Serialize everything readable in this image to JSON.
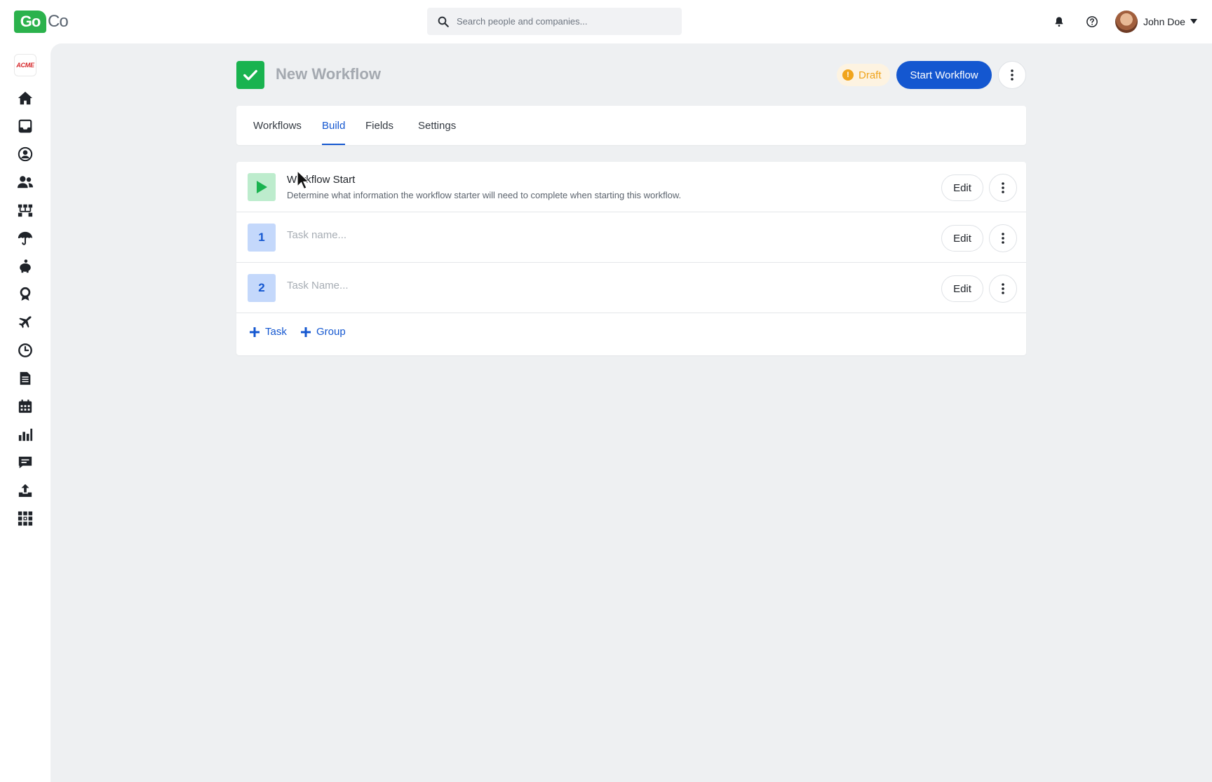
{
  "app": {
    "logo_go": "Go",
    "logo_co": "Co"
  },
  "search": {
    "placeholder": "Search people and companies..."
  },
  "user": {
    "name": "John Doe"
  },
  "sidebar": {
    "company_logo": "ACME",
    "items": [
      {
        "icon": "home-icon"
      },
      {
        "icon": "inbox-icon"
      },
      {
        "icon": "user-circle-icon"
      },
      {
        "icon": "people-icon"
      },
      {
        "icon": "org-chart-icon"
      },
      {
        "icon": "umbrella-icon"
      },
      {
        "icon": "piggy-bank-icon"
      },
      {
        "icon": "award-icon"
      },
      {
        "icon": "airplane-icon"
      },
      {
        "icon": "clock-icon"
      },
      {
        "icon": "document-icon"
      },
      {
        "icon": "calendar-icon"
      },
      {
        "icon": "bar-chart-icon"
      },
      {
        "icon": "chat-icon"
      },
      {
        "icon": "upload-icon"
      },
      {
        "icon": "apps-grid-icon"
      }
    ]
  },
  "workflow": {
    "title": "New Workflow",
    "status": "Draft",
    "start_label": "Start Workflow"
  },
  "tabs": [
    {
      "label": "Workflows",
      "active": false
    },
    {
      "label": "Build",
      "active": true
    },
    {
      "label": "Fields",
      "active": false
    },
    {
      "label": "Settings",
      "active": false
    }
  ],
  "rows": {
    "start": {
      "title": "Workflow Start",
      "description": "Determine what information the workflow starter will need to complete when starting this workflow.",
      "edit_label": "Edit"
    },
    "tasks": [
      {
        "number": "1",
        "placeholder": "Task name...",
        "edit_label": "Edit"
      },
      {
        "number": "2",
        "placeholder": "Task Name...",
        "edit_label": "Edit"
      }
    ]
  },
  "actions": {
    "add_task": "Task",
    "add_group": "Group"
  },
  "colors": {
    "accent": "#1457d0",
    "success": "#19b34f",
    "warning": "#f0a41c"
  }
}
